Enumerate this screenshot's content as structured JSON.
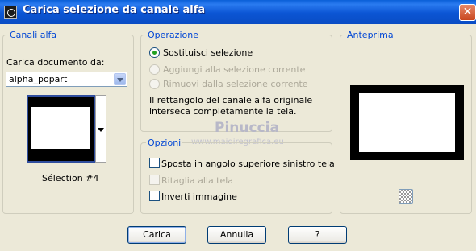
{
  "window": {
    "title": "Carica selezione da canale alfa",
    "close_label": "✕"
  },
  "canali_alfa": {
    "legend": "Canali alfa",
    "load_label": "Carica documento da:",
    "document_value": "alpha_popart",
    "selection_label": "Sélection #4"
  },
  "operazione": {
    "legend": "Operazione",
    "options": [
      {
        "label": "Sostituisci selezione",
        "checked": true,
        "enabled": true
      },
      {
        "label": "Aggiungi alla selezione corrente",
        "checked": false,
        "enabled": false
      },
      {
        "label": "Rimuovi dalla selezione corrente",
        "checked": false,
        "enabled": false
      }
    ],
    "info_line1": "Il rettangolo del canale alfa originale",
    "info_line2": "interseca completamente la tela."
  },
  "opzioni": {
    "legend": "Opzioni",
    "checkboxes": [
      {
        "label": "Sposta in angolo superiore sinistro tela",
        "checked": false,
        "enabled": true
      },
      {
        "label": "Ritaglia alla tela",
        "checked": false,
        "enabled": false
      },
      {
        "label": "Inverti immagine",
        "checked": false,
        "enabled": true
      }
    ]
  },
  "anteprima": {
    "legend": "Anteprima",
    "zoom_icon": "checker-icon"
  },
  "watermark": {
    "name": "Pinuccia",
    "url": "www.maidiregrafica.eu"
  },
  "buttons": {
    "load": "Carica",
    "cancel": "Annulla",
    "help": "?"
  }
}
